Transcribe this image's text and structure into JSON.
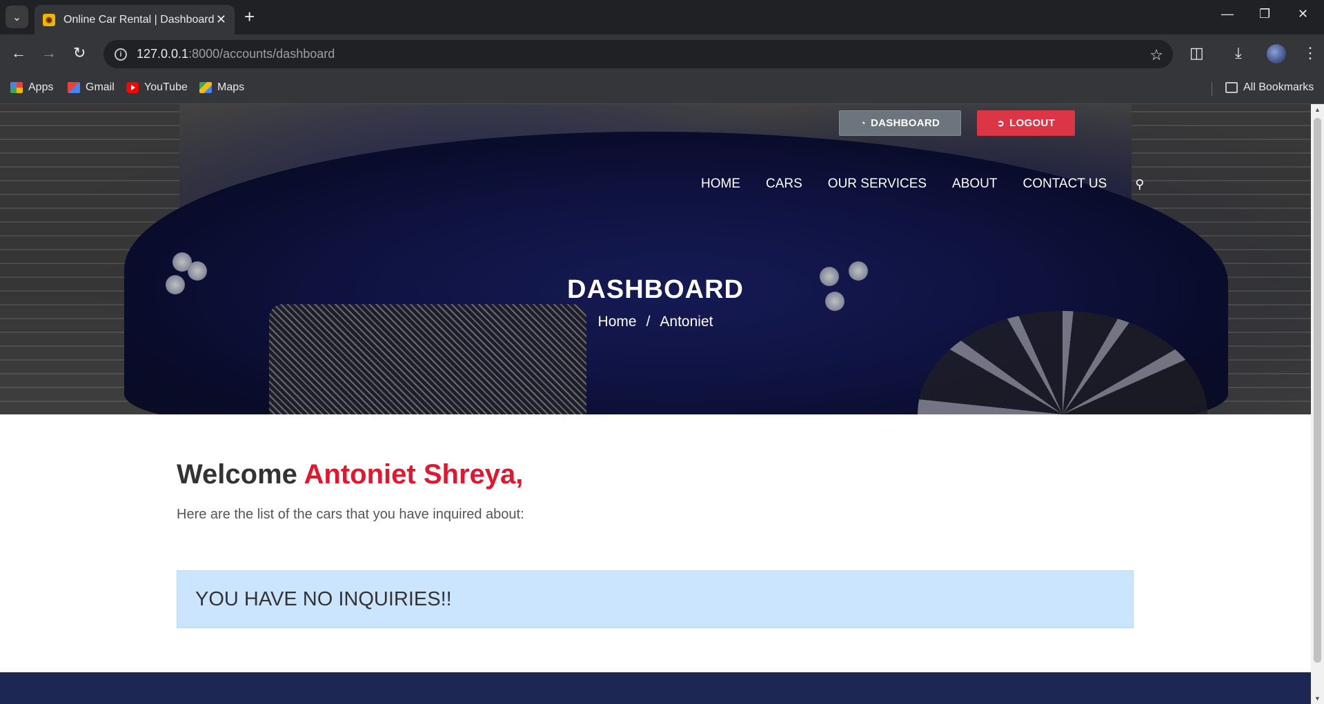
{
  "browser": {
    "tab_title": "Online Car Rental | Dashboard",
    "url_host": "127.0.0.1",
    "url_path": ":8000/accounts/dashboard",
    "bookmarks": [
      {
        "label": "Apps",
        "icon": "apps-icon"
      },
      {
        "label": "Gmail",
        "icon": "gmail-icon"
      },
      {
        "label": "YouTube",
        "icon": "youtube-icon"
      },
      {
        "label": "Maps",
        "icon": "maps-icon"
      }
    ],
    "all_bookmarks": "All Bookmarks"
  },
  "header": {
    "dashboard_button": "DASHBOARD",
    "logout_button": "LOGOUT",
    "nav": [
      "HOME",
      "CARS",
      "OUR SERVICES",
      "ABOUT",
      "CONTACT US"
    ]
  },
  "hero": {
    "title": "DASHBOARD",
    "breadcrumb": {
      "home": "Home",
      "separator": "/",
      "current": "Antoniet"
    }
  },
  "main": {
    "welcome_prefix": "Welcome",
    "user_name": "Antoniet Shreya,",
    "subtitle": "Here are the list of the cars that you have inquired about:",
    "alert": "YOU HAVE NO INQUIRIES!!"
  },
  "colors": {
    "accent_red": "#e3162d",
    "logout_red": "#dc3545",
    "dashboard_gray": "#6c757d",
    "alert_bg": "#cce5ff",
    "footer_navy": "#1d2754"
  }
}
